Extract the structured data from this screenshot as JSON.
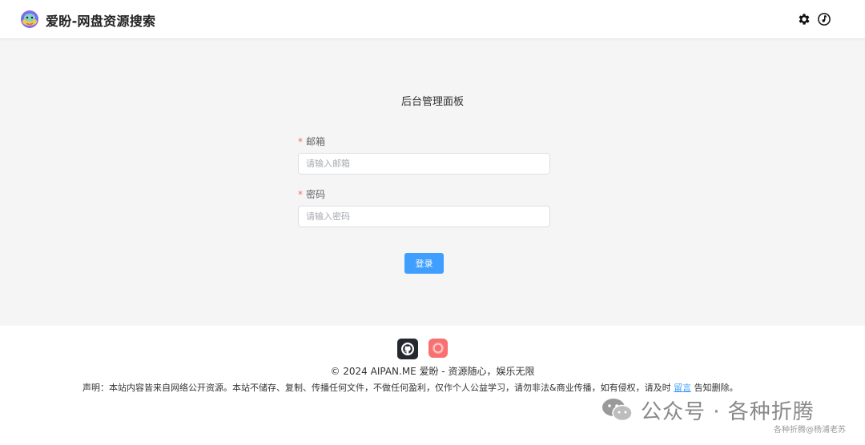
{
  "header": {
    "site_title": "爱盼-网盘资源搜索",
    "logo_icon": "aipan-logo-icon",
    "settings_icon": "gear-icon",
    "music_icon": "music-disc-icon"
  },
  "panel": {
    "title": "后台管理面板",
    "email": {
      "required_mark": "*",
      "label": "邮箱",
      "placeholder": "请输入邮箱",
      "value": ""
    },
    "password": {
      "required_mark": "*",
      "label": "密码",
      "placeholder": "请输入密码",
      "value": ""
    },
    "login_label": "登录"
  },
  "footer": {
    "github_icon": "github-icon",
    "record_icon": "record-icon",
    "copyright": "© 2024 AIPAN.ME 爱盼 - 资源随心，娱乐无限",
    "disclaimer_prefix": "声明：本站内容皆来自网络公开资源。本站不储存、复制、传播任何文件，不做任何盈利，仅作个人公益学习，请勿非法&商业传播，如有侵权，请及时 ",
    "disclaimer_link": "留言",
    "disclaimer_suffix": " 告知删除。"
  },
  "watermark": {
    "text": "公众号 · 各种折腾",
    "sub": "各种折腾@杨浦老苏",
    "icon": "wechat-logo-icon"
  },
  "colors": {
    "primary": "#409eff",
    "required": "#f56c6c",
    "page_bg": "#f5f5f5"
  }
}
